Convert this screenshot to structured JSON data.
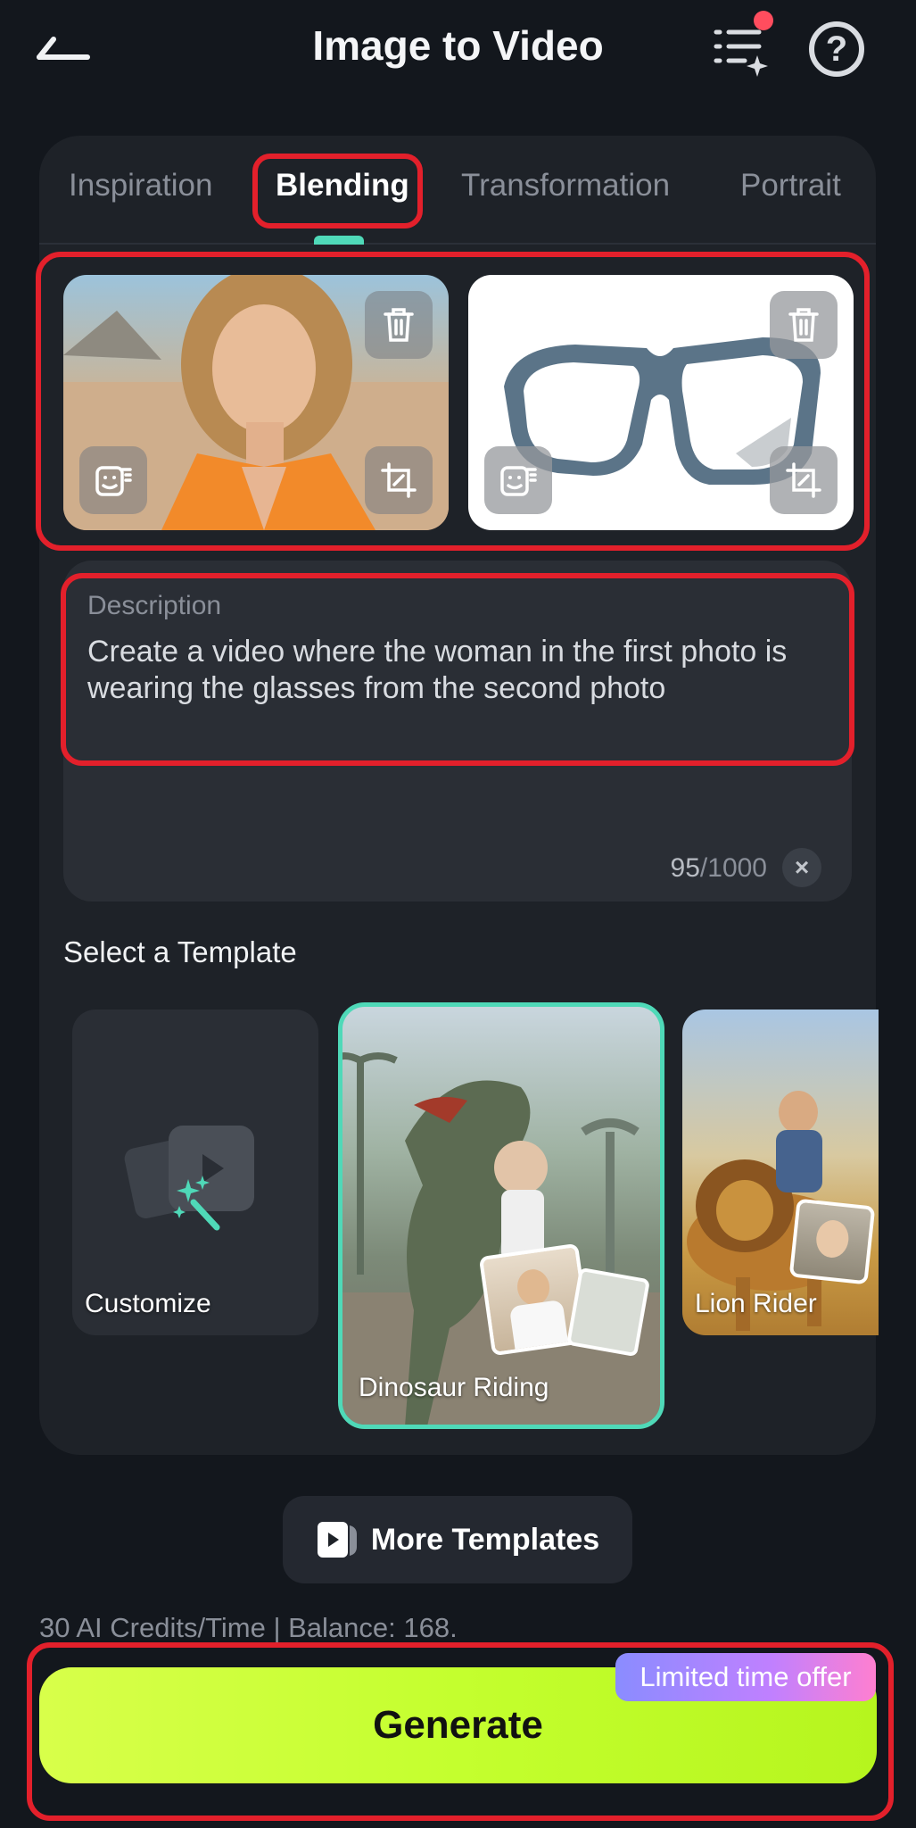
{
  "header": {
    "title": "Image to Video",
    "back_icon": "back-arrow-icon",
    "list_icon": "task-list-sparkle-icon",
    "help_icon": "help-circle-icon",
    "notification_dot_color": "#ff4d5e"
  },
  "tabs": [
    {
      "label": "Inspiration",
      "active": false
    },
    {
      "label": "Blending",
      "active": true
    },
    {
      "label": "Transformation",
      "active": false
    },
    {
      "label": "Portrait",
      "active": false
    }
  ],
  "images": [
    {
      "name": "woman-photo",
      "buttons": [
        "trash-icon",
        "replace-image-icon",
        "crop-icon"
      ]
    },
    {
      "name": "glasses-photo",
      "buttons": [
        "trash-icon",
        "replace-image-icon",
        "crop-icon"
      ]
    }
  ],
  "description": {
    "label": "Description",
    "text": "Create a video where the woman in the first photo is wearing the glasses from the second photo",
    "count": "95",
    "max": "/1000"
  },
  "templates": {
    "section_title": "Select a Template",
    "items": [
      {
        "label": "Customize",
        "selected": false
      },
      {
        "label": "Dinosaur Riding",
        "selected": true
      },
      {
        "label": "Lion Rider",
        "selected": false
      }
    ],
    "more_label": "More Templates"
  },
  "footer": {
    "credits": "30 AI Credits/Time | Balance: 168.",
    "generate_label": "Generate",
    "offer_badge": "Limited time offer"
  },
  "colors": {
    "accent": "#4fd9b8",
    "highlight": "#e3202b",
    "generate": "#c4ff2e",
    "background": "#13171d"
  }
}
